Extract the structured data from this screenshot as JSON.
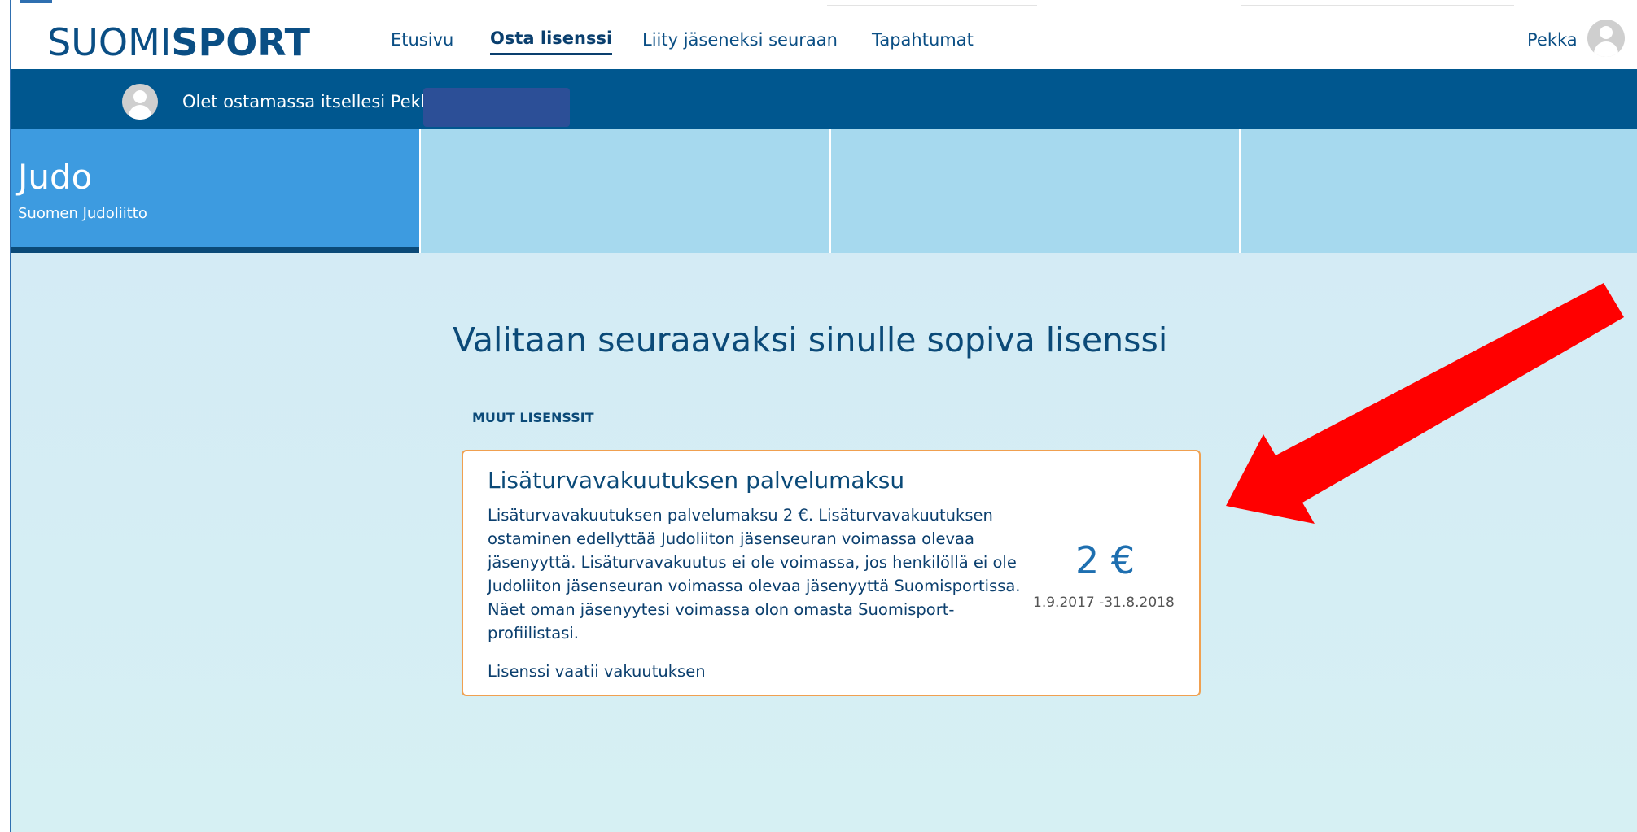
{
  "header": {
    "logo_thin": "SUOMI",
    "logo_bold": "SPORT",
    "nav": [
      {
        "label": "Etusivu"
      },
      {
        "label": "Osta lisenssi",
        "active": true
      },
      {
        "label": "Liity jäseneksi seuraan"
      },
      {
        "label": "Tapahtumat"
      }
    ],
    "user_name": "Pekka",
    "user_icon": "user-avatar-icon"
  },
  "buybar": {
    "text": "Olet ostamassa itsellesi Pekka",
    "avatar_icon": "user-avatar-icon"
  },
  "sports": [
    {
      "title": "Judo",
      "subtitle": "Suomen Judoliitto",
      "active": true
    },
    {
      "title": "",
      "subtitle": ""
    },
    {
      "title": "",
      "subtitle": ""
    },
    {
      "title": "",
      "subtitle": ""
    }
  ],
  "main": {
    "title": "Valitaan seuraavaksi sinulle sopiva lisenssi",
    "section_label": "MUUT LISENSSIT",
    "license_card": {
      "title": "Lisäturvavakuutuksen palvelumaksu",
      "description": "Lisäturvavakuutuksen palvelumaksu 2 €. Lisäturvavakuutuksen ostaminen edellyttää Judoliiton jäsenseuran voimassa olevaa jäsenyyttä. Lisäturvavakuutus ei ole voimassa, jos henkilöllä ei ole Judoliiton jäsenseuran voimassa olevaa jäsenyyttä Suomisportissa. Näet oman jäsenyytesi voimassa olon omasta Suomisport-profiilistasi.",
      "note": "Lisenssi vaatii vakuutuksen",
      "price": "2 €",
      "dates": "1.9.2017 -31.8.2018"
    }
  },
  "colors": {
    "brand_dark": "#0b4a78",
    "bar_blue": "#00578f",
    "tab_active": "#3d9be0",
    "tab_inactive": "#a6d9ee",
    "card_border": "#f0a050",
    "arrow": "#ff0000"
  }
}
